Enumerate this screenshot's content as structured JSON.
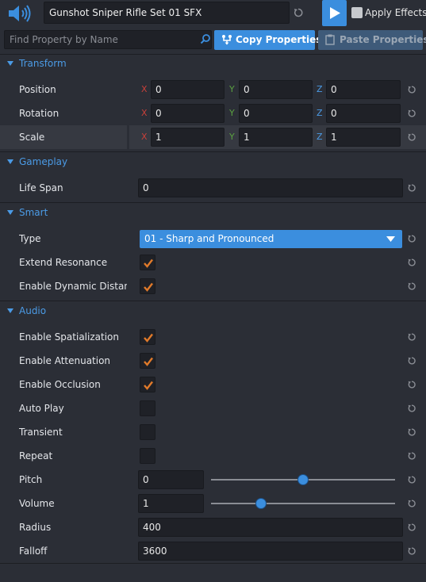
{
  "header": {
    "asset_name": "Gunshot Sniper Rifle Set 01 SFX",
    "apply_effects_label": "Apply Effects",
    "apply_effects_checked": false,
    "speaker_icon": "speaker-icon",
    "play_icon": "play-icon"
  },
  "toolbar": {
    "search_placeholder": "Find Property by Name",
    "copy_label": "Copy Properties",
    "paste_label": "Paste Properties"
  },
  "colors": {
    "accent": "#3b8ede",
    "section_title": "#4b9be6",
    "axis_x": "#c8403a",
    "axis_y": "#5aa040",
    "axis_z": "#4b9be6",
    "check": "#e07a2a"
  },
  "transform": {
    "title": "Transform",
    "axis_labels": {
      "x": "X",
      "y": "Y",
      "z": "Z"
    },
    "position": {
      "label": "Position",
      "x": "0",
      "y": "0",
      "z": "0"
    },
    "rotation": {
      "label": "Rotation",
      "x": "0",
      "y": "0",
      "z": "0"
    },
    "scale": {
      "label": "Scale",
      "x": "1",
      "y": "1",
      "z": "1"
    }
  },
  "gameplay": {
    "title": "Gameplay",
    "life_span": {
      "label": "Life Span",
      "value": "0"
    }
  },
  "smart": {
    "title": "Smart",
    "type": {
      "label": "Type",
      "value": "01 - Sharp and Pronounced"
    },
    "extend_resonance": {
      "label": "Extend Resonance",
      "checked": true
    },
    "enable_dynamic_distance": {
      "label": "Enable Dynamic Distan",
      "checked": true
    }
  },
  "audio": {
    "title": "Audio",
    "enable_spatialization": {
      "label": "Enable Spatialization",
      "checked": true
    },
    "enable_attenuation": {
      "label": "Enable Attenuation",
      "checked": true
    },
    "enable_occlusion": {
      "label": "Enable Occlusion",
      "checked": true
    },
    "auto_play": {
      "label": "Auto Play",
      "checked": false
    },
    "transient": {
      "label": "Transient",
      "checked": false
    },
    "repeat": {
      "label": "Repeat",
      "checked": false
    },
    "pitch": {
      "label": "Pitch",
      "value": "0",
      "slider_fraction": 0.5
    },
    "volume": {
      "label": "Volume",
      "value": "1",
      "slider_fraction": 0.27
    },
    "radius": {
      "label": "Radius",
      "value": "400"
    },
    "falloff": {
      "label": "Falloff",
      "value": "3600"
    }
  }
}
